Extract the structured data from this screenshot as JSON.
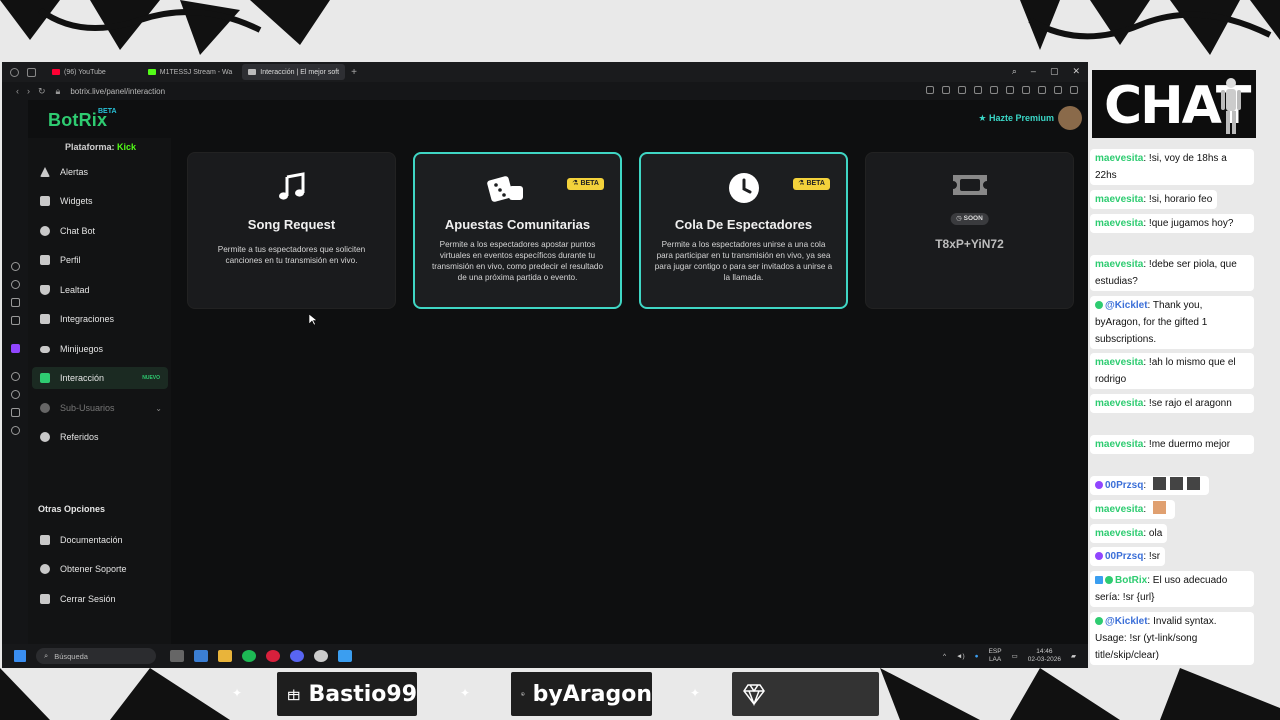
{
  "browser": {
    "tabs": [
      {
        "label": "(96) YouTube",
        "color": "#ff0033"
      },
      {
        "label": "M1TESSJ Stream - Wa",
        "color": "#53fc18"
      },
      {
        "label": "Interacción | El mejor soft",
        "color": "#bbbbbb"
      }
    ],
    "new_tab_glyph": "+",
    "url": "botrix.live/panel/interaction"
  },
  "app": {
    "logo": "BotRix",
    "logo_badge": "BETA",
    "premium_label": "Hazte Premium",
    "platform_label": "Plataforma:",
    "platform_value": "Kick",
    "nav": [
      {
        "label": "Alertas",
        "icon": "alert-icon"
      },
      {
        "label": "Widgets",
        "icon": "grid-icon"
      },
      {
        "label": "Chat Bot",
        "icon": "robot-icon"
      },
      {
        "label": "Perfil",
        "icon": "profile-icon"
      },
      {
        "label": "Lealtad",
        "icon": "trophy-icon"
      },
      {
        "label": "Integraciones",
        "icon": "integrations-icon"
      },
      {
        "label": "Minijuegos",
        "icon": "gamepad-icon"
      },
      {
        "label": "Interacción",
        "icon": "music-icon",
        "badge": "NUEVO"
      },
      {
        "label": "Sub-Usuarios",
        "icon": "subusers-icon"
      },
      {
        "label": "Referidos",
        "icon": "users-icon"
      }
    ],
    "other_title": "Otras Opciones",
    "other": [
      {
        "label": "Documentación",
        "icon": "doc-icon"
      },
      {
        "label": "Obtener Soporte",
        "icon": "support-icon"
      },
      {
        "label": "Cerrar Sesión",
        "icon": "logout-icon"
      }
    ],
    "cards": [
      {
        "title": "Song Request",
        "desc": "Permite a tus espectadores que soliciten canciones en tu transmisión en vivo.",
        "icon": "music-note-icon"
      },
      {
        "title": "Apuestas Comunitarias",
        "badge": "BETA",
        "desc": "Permite a los espectadores apostar puntos virtuales en eventos específicos durante tu transmisión en vivo, como predecir el resultado de una próxima partida o evento.",
        "icon": "dice-icon"
      },
      {
        "title": "Cola De Espectadores",
        "badge": "BETA",
        "desc": "Permite a los espectadores unirse a una cola para participar en tu transmisión en vivo, ya sea para jugar contigo o para ser invitados a unirse a la llamada.",
        "icon": "clock-icon"
      },
      {
        "badge": "SOON",
        "code": "T8xP+YiN72",
        "icon": "ticket-icon"
      }
    ]
  },
  "taskbar": {
    "search_placeholder": "Búsqueda",
    "lang_top": "ESP",
    "lang_bottom": "LAA",
    "time": "14:46",
    "date": "02-03-2026"
  },
  "chat": {
    "title": "CHAT",
    "messages": [
      {
        "user": "maevesita",
        "text": ": !si, voy de 18hs a 22hs"
      },
      {
        "user": "maevesita",
        "text": ": !si, horario feo"
      },
      {
        "user": "maevesita",
        "text": ": !que jugamos hoy?"
      },
      {
        "user": "maevesita",
        "text": ": !debe ser piola, que estudias?"
      },
      {
        "user": "@Kicklet",
        "text": ": Thank you, byAragon, for the gifted 1 subscriptions."
      },
      {
        "user": "maevesita",
        "text": ": !ah lo mismo que el rodrigo"
      },
      {
        "user": "maevesita",
        "text": ": !se rajo el aragonn"
      },
      {
        "user": "maevesita",
        "text": ": !me duermo mejor"
      },
      {
        "user": "00Przsq",
        "text": ":"
      },
      {
        "user": "maevesita",
        "text": ":"
      },
      {
        "user": "maevesita",
        "text": ": ola"
      },
      {
        "user": "00Przsq",
        "text": ": !sr"
      },
      {
        "user": "BotRix",
        "text": ": El uso adecuado sería: !sr {url}"
      },
      {
        "user": "@Kicklet",
        "text": ": Invalid syntax. Usage: !sr (yt-link/song title/skip/clear)"
      }
    ]
  },
  "supporters": [
    {
      "name": "Bastio99",
      "icon": "gift-icon"
    },
    {
      "name": "byAragon",
      "icon": "dollar-icon"
    },
    {
      "name": "",
      "icon": "diamond-icon"
    }
  ],
  "colors": {
    "accent_green": "#2ecc71",
    "accent_teal": "#3fd6c4",
    "beta_yellow": "#f3d23b",
    "kick_green": "#53fc18"
  }
}
